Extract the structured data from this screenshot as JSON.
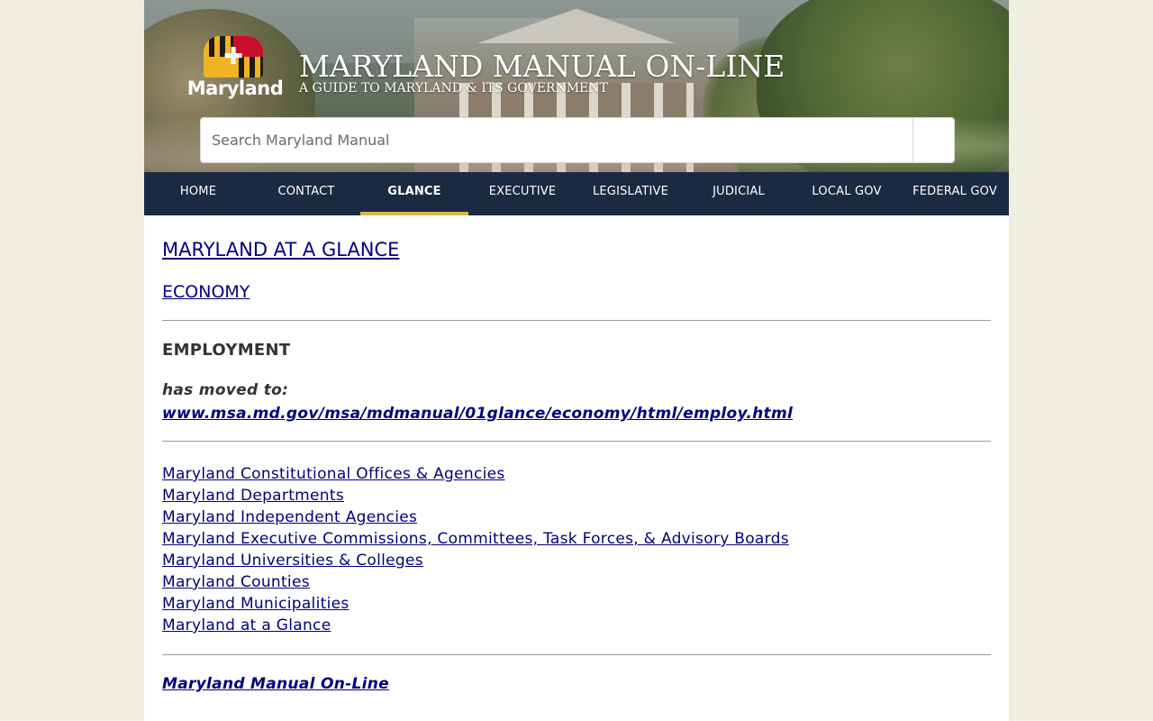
{
  "header": {
    "logo_text": "Maryland",
    "title": "MARYLAND MANUAL ON-LINE",
    "subtitle": "A GUIDE TO MARYLAND & ITS GOVERNMENT"
  },
  "search": {
    "placeholder": "Search Maryland Manual"
  },
  "nav": {
    "items": [
      {
        "label": "HOME"
      },
      {
        "label": "CONTACT"
      },
      {
        "label": "GLANCE"
      },
      {
        "label": "EXECUTIVE"
      },
      {
        "label": "LEGISLATIVE"
      },
      {
        "label": "JUDICIAL"
      },
      {
        "label": "LOCAL GOV"
      },
      {
        "label": "FEDERAL GOV"
      }
    ],
    "active": "GLANCE"
  },
  "main": {
    "heading_link": "MARYLAND AT A GLANCE",
    "subheading_link": "ECONOMY",
    "section_title": "EMPLOYMENT",
    "moved_text": "has moved to:",
    "moved_url": "www.msa.md.gov/msa/mdmanual/01glance/economy/html/employ.html",
    "links": [
      "Maryland Constitutional Offices & Agencies",
      "Maryland Departments",
      "Maryland Independent Agencies",
      "Maryland Executive Commissions, Committees, Task Forces, & Advisory Boards",
      "Maryland Universities & Colleges",
      "Maryland Counties",
      "Maryland Municipalities",
      "Maryland at a Glance"
    ],
    "footer_link": "Maryland Manual On-Line"
  },
  "colors": {
    "nav_bg": "#1b2a43",
    "nav_active_underline": "#d9b74a",
    "link": "#000080",
    "page_bg": "#efeedf"
  }
}
